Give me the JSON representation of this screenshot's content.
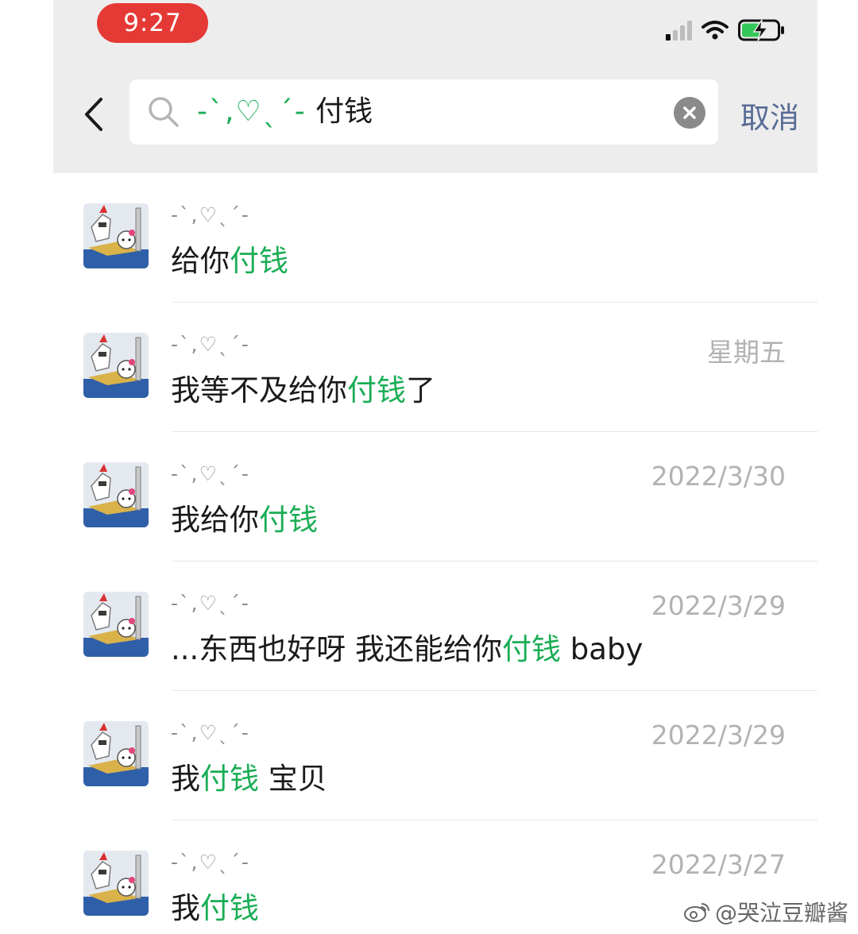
{
  "status_bar": {
    "time": "9:27"
  },
  "search": {
    "query_decoration": "-ˋ,♡ˎˊ-",
    "query_term": "付钱",
    "cancel_label": "取消"
  },
  "results": [
    {
      "name": "-ˋ,♡ˎˊ-",
      "date": "",
      "pre": "给你",
      "highlight": "付钱",
      "post": ""
    },
    {
      "name": "-ˋ,♡ˎˊ-",
      "date": "星期五",
      "pre": "我等不及给你",
      "highlight": "付钱",
      "post": "了"
    },
    {
      "name": "-ˋ,♡ˎˊ-",
      "date": "2022/3/30",
      "pre": "我给你",
      "highlight": "付钱",
      "post": ""
    },
    {
      "name": "-ˋ,♡ˎˊ-",
      "date": "2022/3/29",
      "pre": "...东西也好呀  我还能给你",
      "highlight": "付钱",
      "post": " baby"
    },
    {
      "name": "-ˋ,♡ˎˊ-",
      "date": "2022/3/29",
      "pre": "我",
      "highlight": "付钱",
      "post": " 宝贝"
    },
    {
      "name": "-ˋ,♡ˎˊ-",
      "date": "2022/3/27",
      "pre": "我",
      "highlight": "付钱",
      "post": ""
    }
  ],
  "watermark": {
    "text": "@哭泣豆瓣酱"
  },
  "colors": {
    "highlight": "#1aad55",
    "link": "#576b95",
    "time_pill": "#e53935",
    "battery": "#34c759"
  },
  "icons": [
    "back-chevron-icon",
    "search-icon",
    "clear-icon",
    "signal-icon",
    "wifi-icon",
    "battery-charging-icon",
    "avatar-image",
    "weibo-icon"
  ]
}
